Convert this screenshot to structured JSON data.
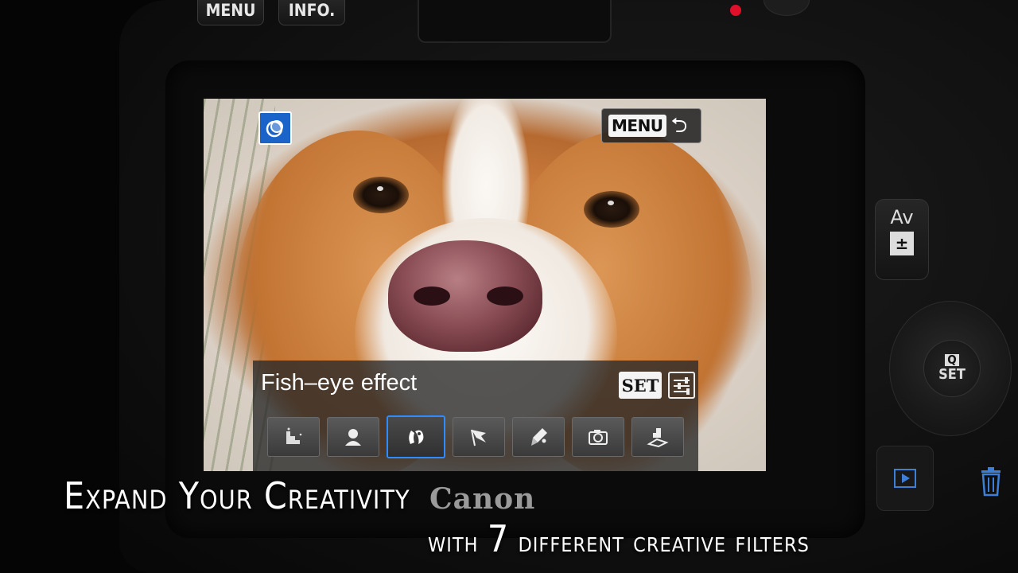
{
  "camera": {
    "top_buttons": [
      "MENU",
      "INFO."
    ],
    "av_button": {
      "label": "Av",
      "exposure_icon": "exposure-compensation-icon"
    },
    "q_set_button": {
      "q_label": "Q",
      "set_label": "SET"
    },
    "playback_icon": "playback-icon",
    "trash_icon": "trash-icon"
  },
  "lcd": {
    "mode_icon": "creative-filter-icon",
    "menu_button": {
      "label": "MENU",
      "icon": "return-arrow-icon"
    },
    "selected_filter_name": "Fish–eye effect",
    "set_chip": "SET",
    "adjust_icon": "adjust-sliders-icon",
    "filters": [
      {
        "name": "grainy-bw-icon",
        "selected": false
      },
      {
        "name": "soft-focus-icon",
        "selected": false
      },
      {
        "name": "fish-eye-icon",
        "selected": true
      },
      {
        "name": "art-bold-icon",
        "selected": false
      },
      {
        "name": "water-painting-icon",
        "selected": false
      },
      {
        "name": "toy-camera-icon",
        "selected": false
      },
      {
        "name": "miniature-icon",
        "selected": false
      }
    ],
    "accent_color": "#2f8cff"
  },
  "caption": {
    "line1": "Expand Your Creativity",
    "brand": "Canon",
    "line2_pre": "with",
    "line2_number": "7",
    "line2_post": "different creative filters"
  }
}
